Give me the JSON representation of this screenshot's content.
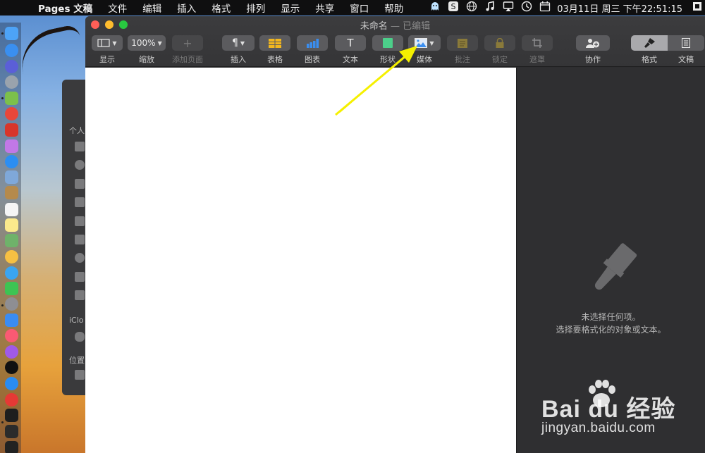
{
  "menubar": {
    "apple_icon": "apple-icon",
    "app_name": "Pages 文稿",
    "items": [
      "文件",
      "编辑",
      "插入",
      "格式",
      "排列",
      "显示",
      "共享",
      "窗口",
      "帮助"
    ],
    "status_icons": [
      "ghost-icon",
      "sogou-icon",
      "globe-icon",
      "music-icon",
      "airplay-icon",
      "clock-icon",
      "calendar-icon"
    ],
    "clock": "03月11日 周三 下午22:51:15"
  },
  "window": {
    "title": "未命名",
    "subtitle": "— 已编辑"
  },
  "toolbar": {
    "view": {
      "label": "显示"
    },
    "zoom": {
      "value": "100%",
      "label": "缩放"
    },
    "add_page": {
      "icon": "+",
      "label": "添加页面"
    },
    "insert": {
      "icon": "¶",
      "label": "插入"
    },
    "table": {
      "label": "表格"
    },
    "chart": {
      "label": "图表"
    },
    "text": {
      "icon": "T",
      "label": "文本"
    },
    "shape": {
      "label": "形状"
    },
    "media": {
      "label": "媒体"
    },
    "comment": {
      "label": "批注"
    },
    "lock": {
      "label": "锁定"
    },
    "mask": {
      "label": "遮罩"
    },
    "collaborate": {
      "label": "协作"
    },
    "format": {
      "label": "格式"
    },
    "document": {
      "label": "文稿"
    }
  },
  "finder": {
    "rows": [
      "个人",
      "iClo",
      "位置"
    ]
  },
  "inspector": {
    "empty_title": "未选择任何项。",
    "empty_hint": "选择要格式化的对象或文本。"
  },
  "colors": {
    "annotation_arrow": "#f5f000",
    "close": "#fe5f57",
    "minimize": "#febc2e",
    "zoom": "#28c840"
  }
}
